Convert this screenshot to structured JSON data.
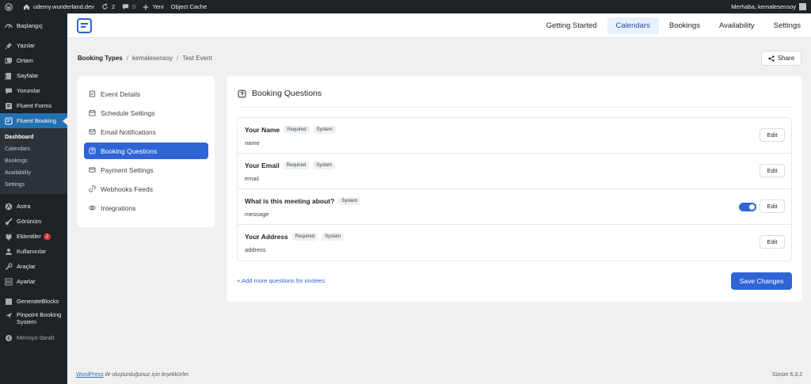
{
  "adminbar": {
    "site": "udemy.wunderland.dev",
    "updates": "2",
    "comments": "0",
    "new_label": "Yeni",
    "object_cache": "Object Cache",
    "greeting": "Merhaba, kemalesensoy"
  },
  "menu": {
    "dashboard": "Başlangıç",
    "posts": "Yazılar",
    "media": "Ortam",
    "pages": "Sayfalar",
    "comments": "Yorumlar",
    "fluent_forms": "Fluent Forms",
    "fluent_booking": "Fluent Booking",
    "sub": [
      "Dashboard",
      "Calendars",
      "Bookings",
      "Availability",
      "Settings"
    ],
    "astra": "Astra",
    "appearance": "Görünüm",
    "plugins": "Eklentiler",
    "plugins_badge": "2",
    "users": "Kullanıcılar",
    "tools": "Araçlar",
    "settings": "Ayarlar",
    "generateblocks": "GenerateBlocks",
    "pinpoint": "Pinpoint Booking System",
    "collapse": "Menüyü daralt"
  },
  "appnav": {
    "links": [
      "Getting Started",
      "Calendars",
      "Bookings",
      "Availability",
      "Settings"
    ],
    "active": "Calendars"
  },
  "breadcrumb": {
    "root": "Booking Types",
    "user": "kemalesensoy",
    "event": "Test Event"
  },
  "share_label": "Share",
  "settings_nav": [
    "Event Details",
    "Schedule Settings",
    "Email Notifications",
    "Booking Questions",
    "Payment Settings",
    "Webhooks Feeds",
    "Integrations"
  ],
  "booking_questions": {
    "title": "Booking Questions",
    "edit_label": "Edit",
    "questions": [
      {
        "label": "Your Name",
        "required": "Required",
        "system": "System",
        "field": "name"
      },
      {
        "label": "Your Email",
        "required": "Required",
        "system": "System",
        "field": "email"
      },
      {
        "label": "What is this meeting about?",
        "system": "System",
        "field": "message",
        "toggle": "on"
      },
      {
        "label": "Your Address",
        "required": "Required",
        "system": "System",
        "field": "address"
      }
    ],
    "add_more": "+ Add more questions for invitees",
    "save": "Save Changes"
  },
  "footer": {
    "wp_link": "WordPress",
    "thanks": " ile oluşturduğunuz için teşekkürler.",
    "version": "Sürüm 6.3.2"
  },
  "colors": {
    "primary": "#2e64d6",
    "admin_dark": "#1d2327",
    "admin_active": "#2271b1"
  }
}
